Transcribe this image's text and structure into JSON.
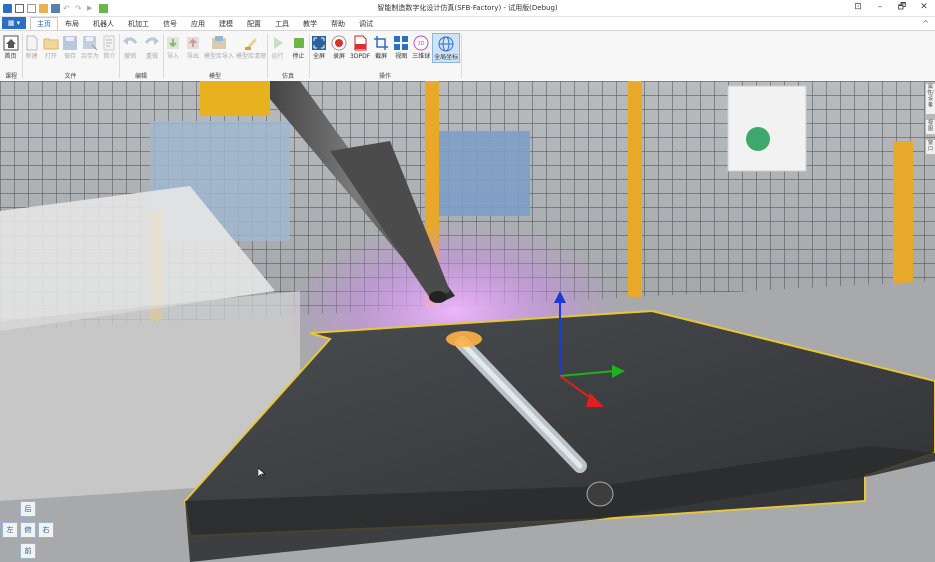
{
  "window": {
    "title": "智能制造数字化设计仿真(SFB-Factory) - 试用版(Debug)",
    "controls": [
      "⊡",
      "–",
      "🗗",
      "✕"
    ]
  },
  "tabbar": {
    "file_label": "▦ ▾",
    "tabs": [
      "主页",
      "布局",
      "机器人",
      "机加工",
      "信号",
      "应用",
      "建模",
      "配置",
      "工具",
      "教学",
      "帮助",
      "调试"
    ],
    "active_tab": "主页",
    "collapse_icon": "^"
  },
  "ribbon": {
    "groups": [
      {
        "label": "课程",
        "buttons": [
          {
            "label": "首页",
            "icon": "home-icon",
            "enabled": true
          }
        ]
      },
      {
        "label": "文件",
        "buttons": [
          {
            "label": "新建",
            "icon": "new-file-icon",
            "enabled": false
          },
          {
            "label": "打开",
            "icon": "open-folder-icon",
            "enabled": false
          },
          {
            "label": "保存",
            "icon": "save-icon",
            "enabled": false
          },
          {
            "label": "另存为",
            "icon": "save-as-icon",
            "enabled": false
          },
          {
            "label": "简介",
            "icon": "info-icon",
            "enabled": false
          }
        ]
      },
      {
        "label": "编辑",
        "buttons": [
          {
            "label": "撤销",
            "icon": "undo-icon",
            "enabled": false
          },
          {
            "label": "重做",
            "icon": "redo-icon",
            "enabled": false
          }
        ]
      },
      {
        "label": "模型",
        "buttons": [
          {
            "label": "导入",
            "icon": "import-icon",
            "enabled": false
          },
          {
            "label": "导出",
            "icon": "export-icon",
            "enabled": false
          },
          {
            "label": "模型库导入",
            "icon": "library-import-icon",
            "enabled": false
          },
          {
            "label": "模型库清理",
            "icon": "library-clean-icon",
            "enabled": false
          }
        ]
      },
      {
        "label": "仿真",
        "buttons": [
          {
            "label": "运行",
            "icon": "run-icon",
            "enabled": false
          },
          {
            "label": "停止",
            "icon": "stop-icon",
            "enabled": true
          }
        ]
      },
      {
        "label": "操作",
        "buttons": [
          {
            "label": "全屏",
            "icon": "fullscreen-icon",
            "enabled": true
          },
          {
            "label": "录屏",
            "icon": "record-icon",
            "enabled": true
          },
          {
            "label": "3DPDF",
            "icon": "pdf-icon",
            "enabled": true
          },
          {
            "label": "截屏",
            "icon": "screenshot-icon",
            "enabled": true
          },
          {
            "label": "视图",
            "icon": "view-icon",
            "enabled": true
          },
          {
            "label": "三维球",
            "icon": "sphere-icon",
            "enabled": true
          },
          {
            "label": "全局坐标",
            "icon": "global-axis-icon",
            "enabled": true,
            "selected": true
          }
        ]
      }
    ]
  },
  "navpad": {
    "back": "后",
    "left": "左",
    "down": "俯",
    "right": "右",
    "front": "前"
  },
  "sidetabs": [
    "属性/设备",
    "视图",
    "窗口"
  ],
  "colors": {
    "accent": "#2b6fc2",
    "weld_glow": "#d08cf0",
    "plate_outline": "#e8c63a"
  }
}
